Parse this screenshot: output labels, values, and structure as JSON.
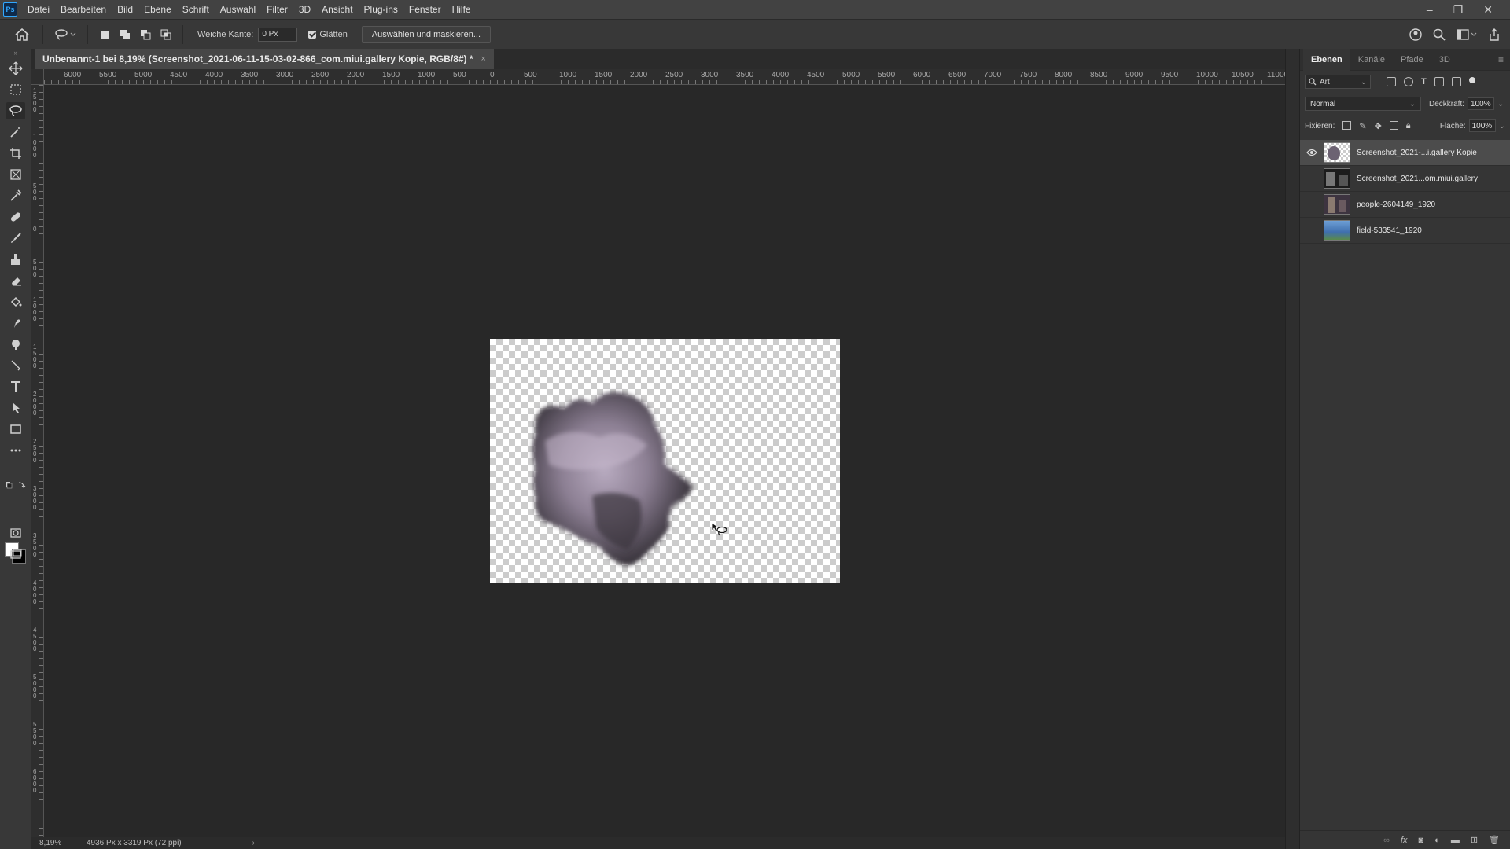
{
  "app": {
    "logo": "Ps"
  },
  "menu": [
    "Datei",
    "Bearbeiten",
    "Bild",
    "Ebene",
    "Schrift",
    "Auswahl",
    "Filter",
    "3D",
    "Ansicht",
    "Plug-ins",
    "Fenster",
    "Hilfe"
  ],
  "window_controls": {
    "minimize": "–",
    "restore": "❐",
    "close": "✕"
  },
  "options": {
    "feather_label": "Weiche Kante:",
    "feather_value": "0 Px",
    "antialias_label": "Glätten",
    "antialias_checked": true,
    "select_mask_button": "Auswählen und maskieren..."
  },
  "document_tab": {
    "title": "Unbenannt-1 bei 8,19% (Screenshot_2021-06-11-15-03-02-866_com.miui.gallery Kopie, RGB/8#) *",
    "close": "×"
  },
  "ruler_h_labels": [
    "6000",
    "5500",
    "5000",
    "4500",
    "4000",
    "3500",
    "3000",
    "2500",
    "2000",
    "1500",
    "1000",
    "500",
    "0",
    "500",
    "1000",
    "1500",
    "2000",
    "2500",
    "3000",
    "3500",
    "4000",
    "4500",
    "5000",
    "5500",
    "6000",
    "6500",
    "7000",
    "7500",
    "8000",
    "8500",
    "9000",
    "9500",
    "10000",
    "10500",
    "11000"
  ],
  "ruler_v_labels": [
    "1 5 0 0",
    "1 0 0 0",
    "5 0 0",
    "0",
    "5 0 0",
    "1 0 0 0",
    "1 5 0 0",
    "2 0 0 0",
    "2 5 0 0",
    "3 0 0 0",
    "3 5 0 0",
    "4 0 0 0",
    "4 5 0 0",
    "5 0 0 0",
    "5 5 0 0",
    "6 0 0 0"
  ],
  "status": {
    "zoom": "8,19%",
    "info": "4936 Px x 3319 Px (72 ppi)",
    "arrow": "›"
  },
  "panel": {
    "tabs": [
      "Ebenen",
      "Kanäle",
      "Pfade",
      "3D"
    ],
    "active_tab": "Ebenen",
    "filter_placeholder": "Art",
    "blend_mode": "Normal",
    "opacity_label": "Deckkraft:",
    "opacity_value": "100%",
    "lock_label": "Fixieren:",
    "fill_label": "Fläche:",
    "fill_value": "100%"
  },
  "layers": [
    {
      "name": "Screenshot_2021-...i.gallery Kopie",
      "visible": true,
      "selected": true
    },
    {
      "name": "Screenshot_2021...om.miui.gallery",
      "visible": false,
      "selected": false
    },
    {
      "name": "people-2604149_1920",
      "visible": false,
      "selected": false
    },
    {
      "name": "field-533541_1920",
      "visible": false,
      "selected": false
    }
  ],
  "colors": {
    "accent": "#31a8ff",
    "foreground": "#ffffff",
    "background": "#000000"
  }
}
